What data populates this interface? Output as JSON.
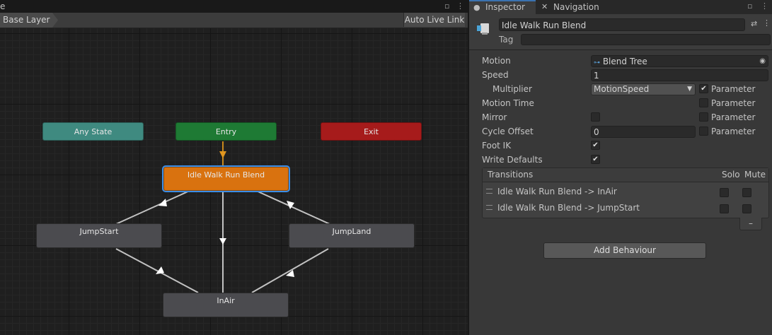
{
  "animator": {
    "tab_title": "e",
    "breadcrumb": "Base Layer",
    "auto_live_link": "Auto Live Link",
    "nodes": {
      "any_state": "Any State",
      "entry": "Entry",
      "exit": "Exit",
      "idle_walk_run": "Idle Walk Run Blend",
      "jump_start": "JumpStart",
      "jump_land": "JumpLand",
      "in_air": "InAir"
    }
  },
  "inspector": {
    "tabs": {
      "inspector": "Inspector",
      "navigation": "Navigation"
    },
    "object_name": "Idle Walk Run Blend",
    "tag_label": "Tag",
    "motion": {
      "label": "Motion",
      "value": "Blend Tree"
    },
    "speed": {
      "label": "Speed",
      "value": "1"
    },
    "multiplier": {
      "label": "Multiplier",
      "value": "MotionSpeed",
      "parameter_label": "Parameter",
      "parameter_checked": true
    },
    "motion_time": {
      "label": "Motion Time",
      "parameter_label": "Parameter"
    },
    "mirror": {
      "label": "Mirror",
      "parameter_label": "Parameter"
    },
    "cycle_offset": {
      "label": "Cycle Offset",
      "value": "0",
      "parameter_label": "Parameter"
    },
    "foot_ik": {
      "label": "Foot IK",
      "checked": true
    },
    "write_defaults": {
      "label": "Write Defaults",
      "checked": true
    },
    "transitions": {
      "header": "Transitions",
      "solo": "Solo",
      "mute": "Mute",
      "items": [
        {
          "label": "Idle Walk Run Blend -> InAir"
        },
        {
          "label": "Idle Walk Run Blend -> JumpStart"
        }
      ],
      "remove_label": "–"
    },
    "add_behaviour": "Add Behaviour"
  },
  "colors": {
    "selected_outline": "#3b8ee8",
    "default_state": "#d9720f",
    "entry": "#1e7a34",
    "exit": "#a61b1b",
    "any_state": "#3f8a80"
  }
}
